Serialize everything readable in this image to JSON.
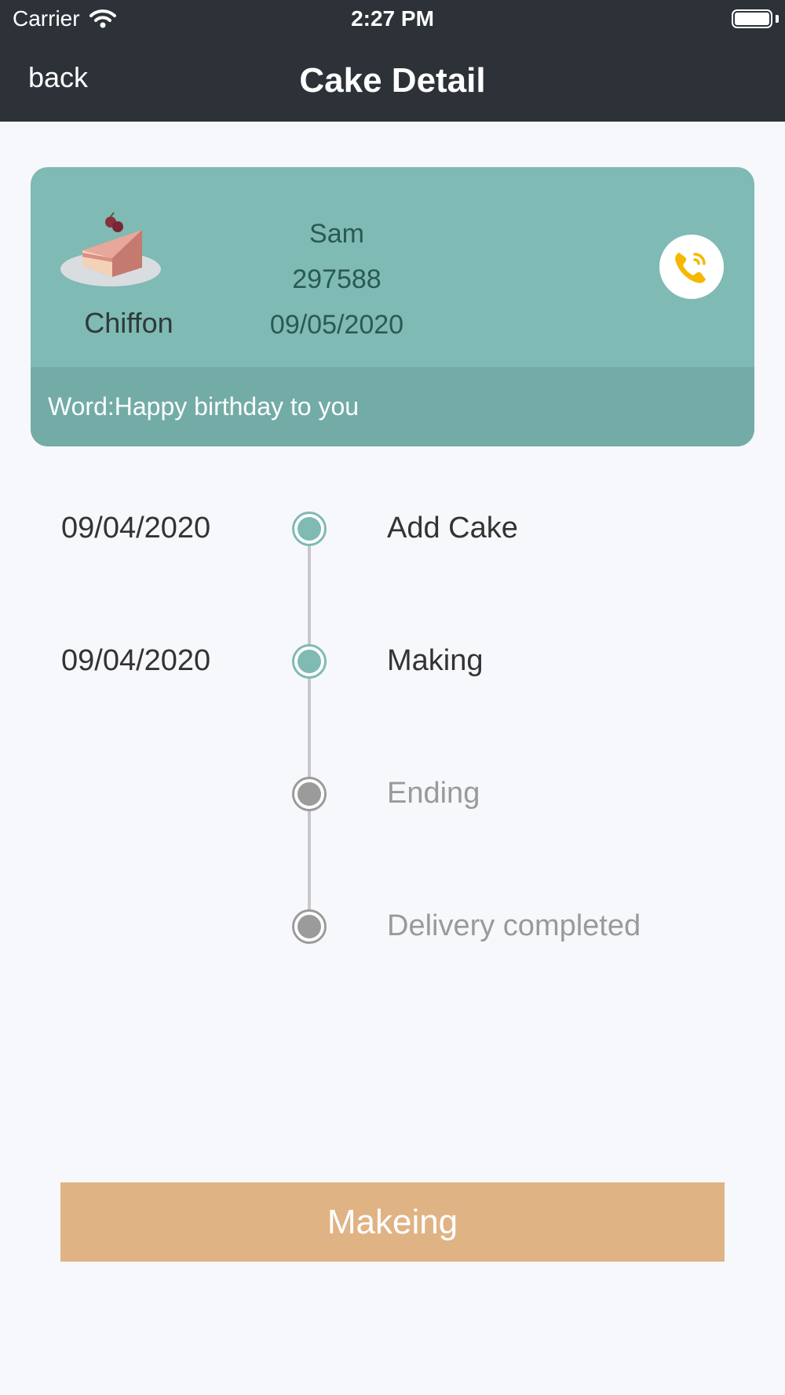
{
  "status_bar": {
    "carrier": "Carrier",
    "time": "2:27 PM"
  },
  "nav": {
    "back_label": "back",
    "title": "Cake Detail"
  },
  "order": {
    "cake_name": "Chiffon",
    "customer_name": "Sam",
    "order_number": "297588",
    "order_date": "09/05/2020",
    "word": "Word:Happy birthday to you"
  },
  "timeline": [
    {
      "date": "09/04/2020",
      "label": "Add Cake",
      "status": "done"
    },
    {
      "date": "09/04/2020",
      "label": "Making",
      "status": "done"
    },
    {
      "date": "",
      "label": "Ending",
      "status": "todo"
    },
    {
      "date": "",
      "label": "Delivery completed",
      "status": "todo"
    }
  ],
  "action_button_label": "Makeing",
  "colors": {
    "header_bg": "#2d3238",
    "card_bg": "#7fbab4",
    "word_bar_bg": "#73aca6",
    "done_accent": "#7fbab4",
    "todo_gray": "#9b9b9b",
    "button_bg": "#e0b385",
    "phone_icon": "#f5b800"
  },
  "icons": {
    "wifi": "wifi-icon",
    "battery": "battery-icon",
    "cake": "cake-slice-icon",
    "phone": "phone-icon"
  }
}
